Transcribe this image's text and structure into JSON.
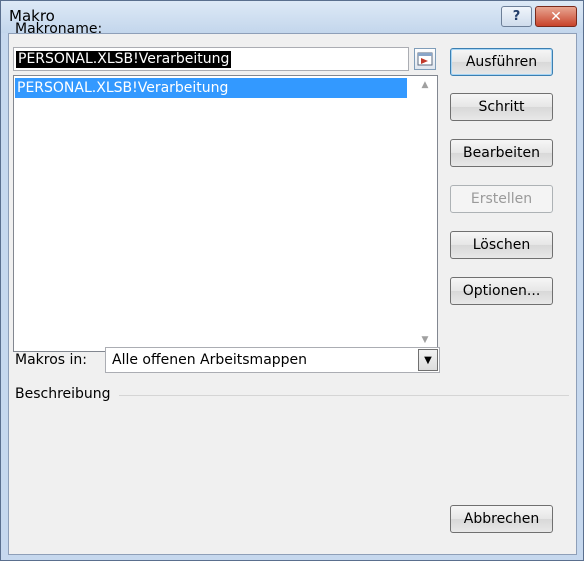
{
  "window": {
    "title": "Makro"
  },
  "titlebar": {
    "help_label": "?",
    "close_label": "✕"
  },
  "macro_name": {
    "label": "Makroname:",
    "value": "PERSONAL.XLSB!Verarbeitung"
  },
  "macro_list": {
    "items": [
      "PERSONAL.XLSB!Verarbeitung"
    ],
    "selected_index": 0
  },
  "buttons": {
    "run": "Ausführen",
    "step": "Schritt",
    "edit": "Bearbeiten",
    "create": "Erstellen",
    "delete": "Löschen",
    "options": "Optionen...",
    "cancel": "Abbrechen"
  },
  "macros_in": {
    "label": "Makros in:",
    "value": "Alle offenen Arbeitsmappen"
  },
  "description": {
    "label": "Beschreibung"
  },
  "colors": {
    "selection": "#3399ff",
    "frame": "#c6d8ee",
    "close": "#c8432b"
  }
}
